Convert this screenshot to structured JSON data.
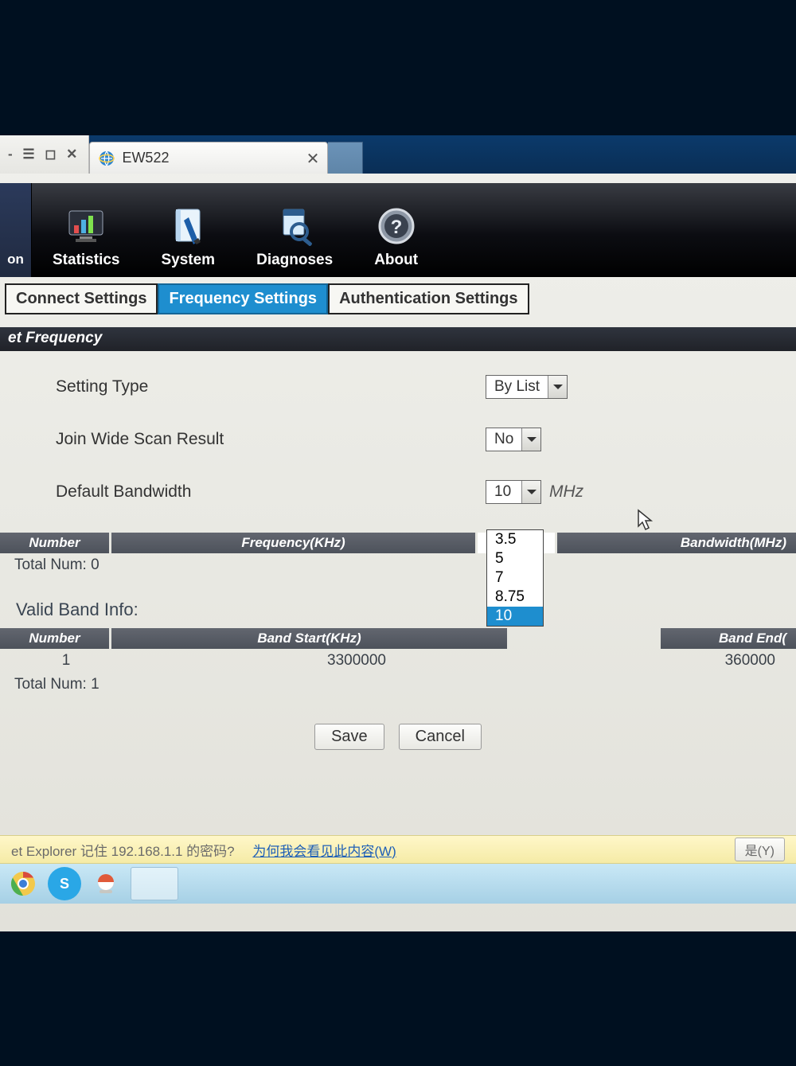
{
  "browser": {
    "tab_title": "EW522",
    "toolbar_glyphs": "- ☰ ◻ ✕"
  },
  "mainnav": {
    "leading_frag": "on",
    "items": [
      {
        "label": "Statistics"
      },
      {
        "label": "System"
      },
      {
        "label": "Diagnoses"
      },
      {
        "label": "About"
      }
    ]
  },
  "subtabs": {
    "items": [
      {
        "label": "Connect Settings",
        "active": false
      },
      {
        "label": "Frequency Settings",
        "active": true
      },
      {
        "label": "Authentication Settings",
        "active": false
      }
    ]
  },
  "section_title": "et Frequency",
  "form": {
    "setting_type": {
      "label": "Setting Type",
      "value": "By List"
    },
    "join_wide_scan": {
      "label": "Join Wide Scan Result",
      "value": "No"
    },
    "default_bandwidth": {
      "label": "Default Bandwidth",
      "value": "10",
      "unit": "MHz",
      "options": [
        "3.5",
        "5",
        "7",
        "8.75",
        "10"
      ],
      "highlighted": "10"
    }
  },
  "freq_table": {
    "headers": [
      "Number",
      "Frequency(KHz)",
      "Bandwidth(MHz)"
    ],
    "total_label": "Total Num: 0"
  },
  "valid_band": {
    "heading": "Valid Band Info:",
    "headers": [
      "Number",
      "Band Start(KHz)",
      "Band End("
    ],
    "rows": [
      {
        "number": "1",
        "start": "3300000",
        "end": "360000"
      }
    ],
    "total_label": "Total Num: 1"
  },
  "buttons": {
    "save": "Save",
    "cancel": "Cancel"
  },
  "infobar": {
    "text": "et Explorer 记住 192.168.1.1 的密码?",
    "link": "为何我会看见此内容(W)",
    "yes": "是(Y)"
  }
}
